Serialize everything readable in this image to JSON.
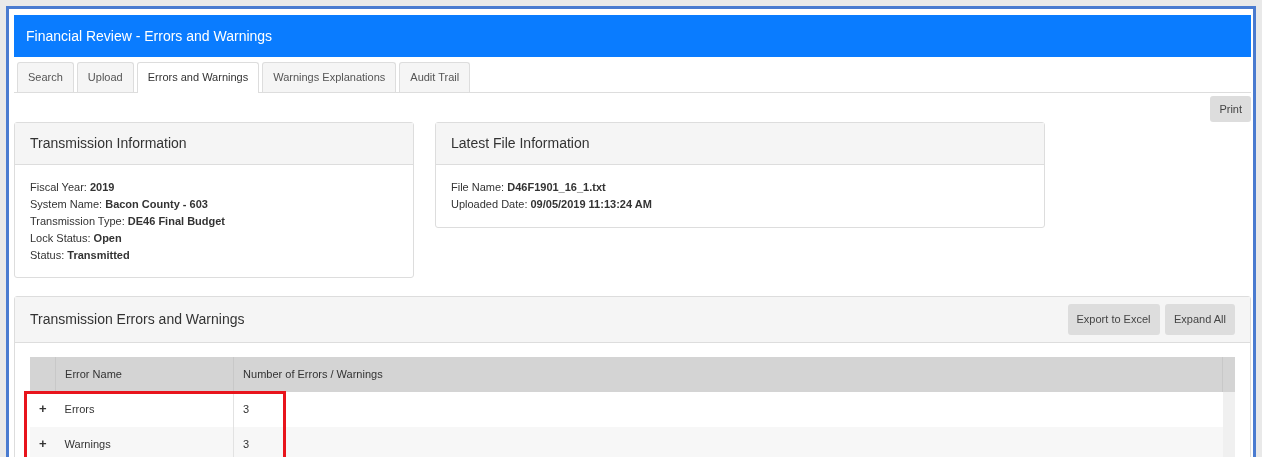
{
  "window": {
    "title": "Financial Review - Errors and Warnings"
  },
  "tabs": [
    {
      "label": "Search",
      "selected": false
    },
    {
      "label": "Upload",
      "selected": false
    },
    {
      "label": "Errors and Warnings",
      "selected": true
    },
    {
      "label": "Warnings Explanations",
      "selected": false
    },
    {
      "label": "Audit Trail",
      "selected": false
    }
  ],
  "print_button": "Print",
  "transmission_info": {
    "title": "Transmission Information",
    "fields": [
      {
        "label": "Fiscal Year:",
        "value": "2019"
      },
      {
        "label": "System Name:",
        "value": "Bacon County - 603"
      },
      {
        "label": "Transmission Type:",
        "value": "DE46 Final Budget"
      },
      {
        "label": "Lock Status:",
        "value": "Open"
      },
      {
        "label": "Status:",
        "value": "Transmitted"
      }
    ]
  },
  "file_info": {
    "title": "Latest File Information",
    "fields": [
      {
        "label": "File Name:",
        "value": "D46F1901_16_1.txt"
      },
      {
        "label": "Uploaded Date:",
        "value": "09/05/2019 11:13:24 AM"
      }
    ]
  },
  "errors_panel": {
    "title": "Transmission Errors and Warnings",
    "buttons": [
      "Export to Excel",
      "Expand All"
    ],
    "table": {
      "columns": [
        "Error Name",
        "Number of Errors / Warnings"
      ],
      "rows": [
        {
          "toggle": "+",
          "name": "Errors",
          "count": "3",
          "highlighted": true
        },
        {
          "toggle": "+",
          "name": "Warnings",
          "count": "3",
          "highlighted": true
        }
      ]
    }
  }
}
